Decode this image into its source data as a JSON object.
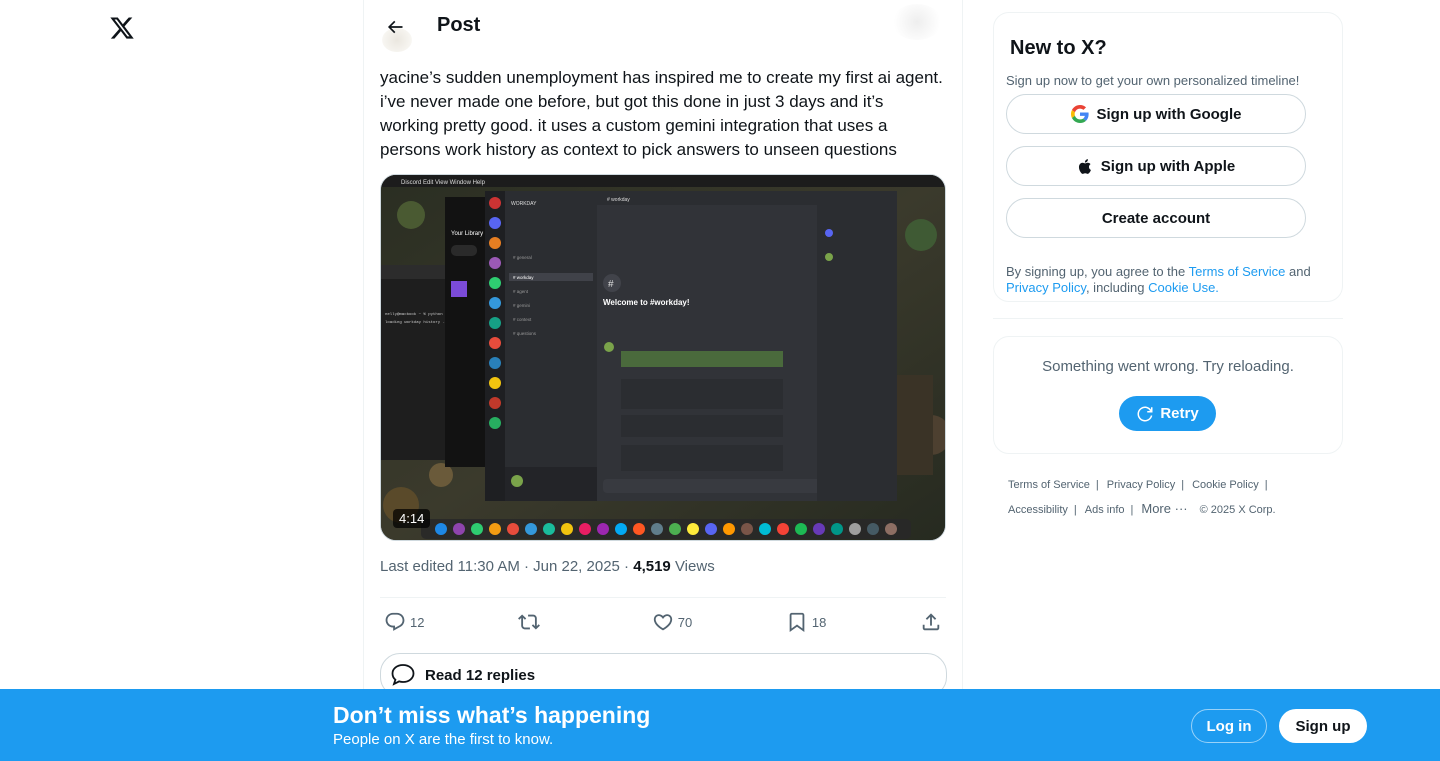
{
  "header": {
    "title": "Post"
  },
  "post": {
    "text": "yacine’s sudden unemployment has inspired me to create my first ai agent. i’ve never made one before, but got this done in just 3 days and it’s working pretty good. it uses a custom gemini integration that uses a persons work history as context to pick answers to unseen questions",
    "video_duration": "4:14",
    "edited_prefix": "Last edited 11:30 AM · Jun 22, 2025 · ",
    "views_count": "4,519",
    "views_label": " Views",
    "video_content": {
      "channel_title": "Welcome to #workday!",
      "channel_name": "workday",
      "sidebar_header": "Your Library"
    }
  },
  "actions": {
    "replies": "12",
    "retweets": "",
    "likes": "70",
    "bookmarks": "18"
  },
  "read_replies": "Read 12 replies",
  "signup_card": {
    "title": "New to X?",
    "subtitle": "Sign up now to get your own personalized timeline!",
    "google_label": "Sign up with Google",
    "apple_label": "Sign up with Apple",
    "create_label": "Create account",
    "terms_prefix": "By signing up, you agree to the ",
    "terms_link": "Terms of Service",
    "terms_and": " and ",
    "privacy_link": "Privacy Policy",
    "including": ", including ",
    "cookie_link": "Cookie Use."
  },
  "error_card": {
    "message": "Something went wrong. Try reloading.",
    "retry_label": "Retry"
  },
  "footer": {
    "terms": "Terms of Service",
    "privacy": "Privacy Policy",
    "cookie": "Cookie Policy",
    "accessibility": "Accessibility",
    "ads": "Ads info",
    "more": "More",
    "copyright": "© 2025 X Corp."
  },
  "bottom_bar": {
    "title": "Don’t miss what’s happening",
    "subtitle": "People on X are the first to know.",
    "login_label": "Log in",
    "signup_label": "Sign up"
  },
  "colors": {
    "accent": "#1d9bf0",
    "text_primary": "#0f1419",
    "text_secondary": "#536471"
  }
}
